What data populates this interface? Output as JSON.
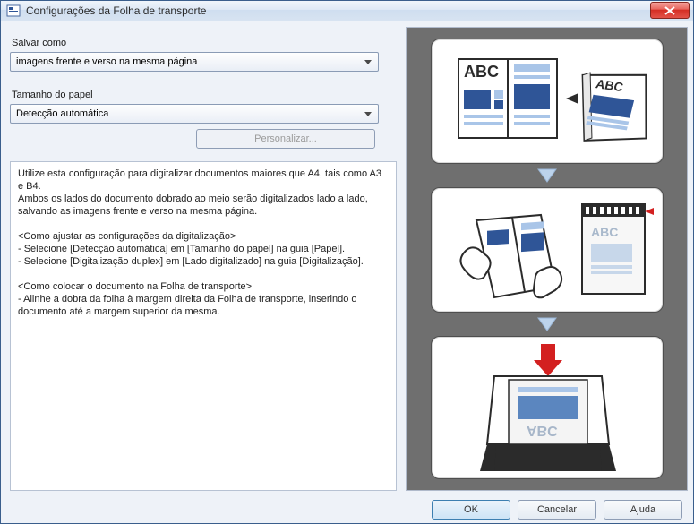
{
  "window": {
    "title": "Configurações da Folha de transporte"
  },
  "form": {
    "saveAsLabel": "Salvar como",
    "saveAsValue": "imagens frente e verso na mesma página",
    "paperSizeLabel": "Tamanho do papel",
    "paperSizeValue": "Detecção automática",
    "customizeLabel": "Personalizar..."
  },
  "description": "Utilize esta configuração para digitalizar documentos maiores que A4, tais como A3 e B4.\nAmbos os lados do documento dobrado ao meio serão digitalizados lado a lado, salvando as imagens frente e verso na mesma página.\n\n<Como ajustar as configurações da digitalização>\n- Selecione [Detecção automática] em [Tamanho do papel] na guia [Papel].\n- Selecione [Digitalização duplex] em [Lado digitalizado] na guia [Digitalização].\n\n<Como colocar o documento na Folha de transporte>\n- Alinhe a dobra da folha à margem direita da Folha de transporte, inserindo o documento até a margem superior da mesma.",
  "illustrations": {
    "docText": "ABC"
  },
  "buttons": {
    "ok": "OK",
    "cancel": "Cancelar",
    "help": "Ajuda"
  }
}
